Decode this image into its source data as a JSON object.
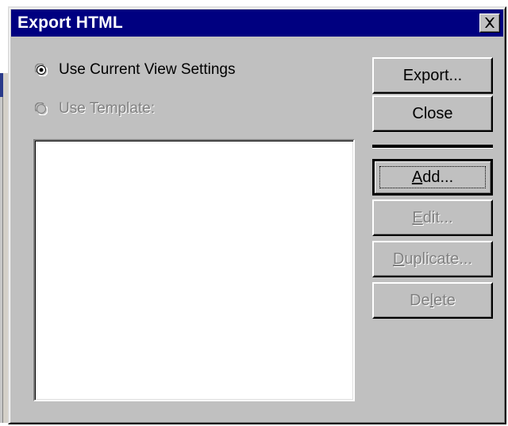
{
  "dialog": {
    "title": "Export HTML",
    "close_icon": "close-x-icon"
  },
  "options": {
    "current_view": {
      "label": "Use Current View Settings",
      "selected": true,
      "enabled": true
    },
    "template": {
      "label": "Use Template:",
      "selected": false,
      "enabled": false
    }
  },
  "template_list": {
    "items": []
  },
  "buttons": {
    "export": {
      "label": "Export...",
      "enabled": true
    },
    "close": {
      "label": "Close",
      "enabled": true
    },
    "add": {
      "pre": "",
      "mnemonic": "A",
      "post": "dd...",
      "enabled": true
    },
    "edit": {
      "pre": "",
      "mnemonic": "E",
      "post": "dit...",
      "enabled": false
    },
    "duplicate": {
      "pre": "",
      "mnemonic": "D",
      "post": "uplicate...",
      "enabled": false
    },
    "delete": {
      "pre": "De",
      "mnemonic": "l",
      "post": "ete",
      "enabled": false
    }
  },
  "colors": {
    "titlebar": "#000080",
    "face": "#c0c0c0",
    "disabled_text": "#808080"
  }
}
